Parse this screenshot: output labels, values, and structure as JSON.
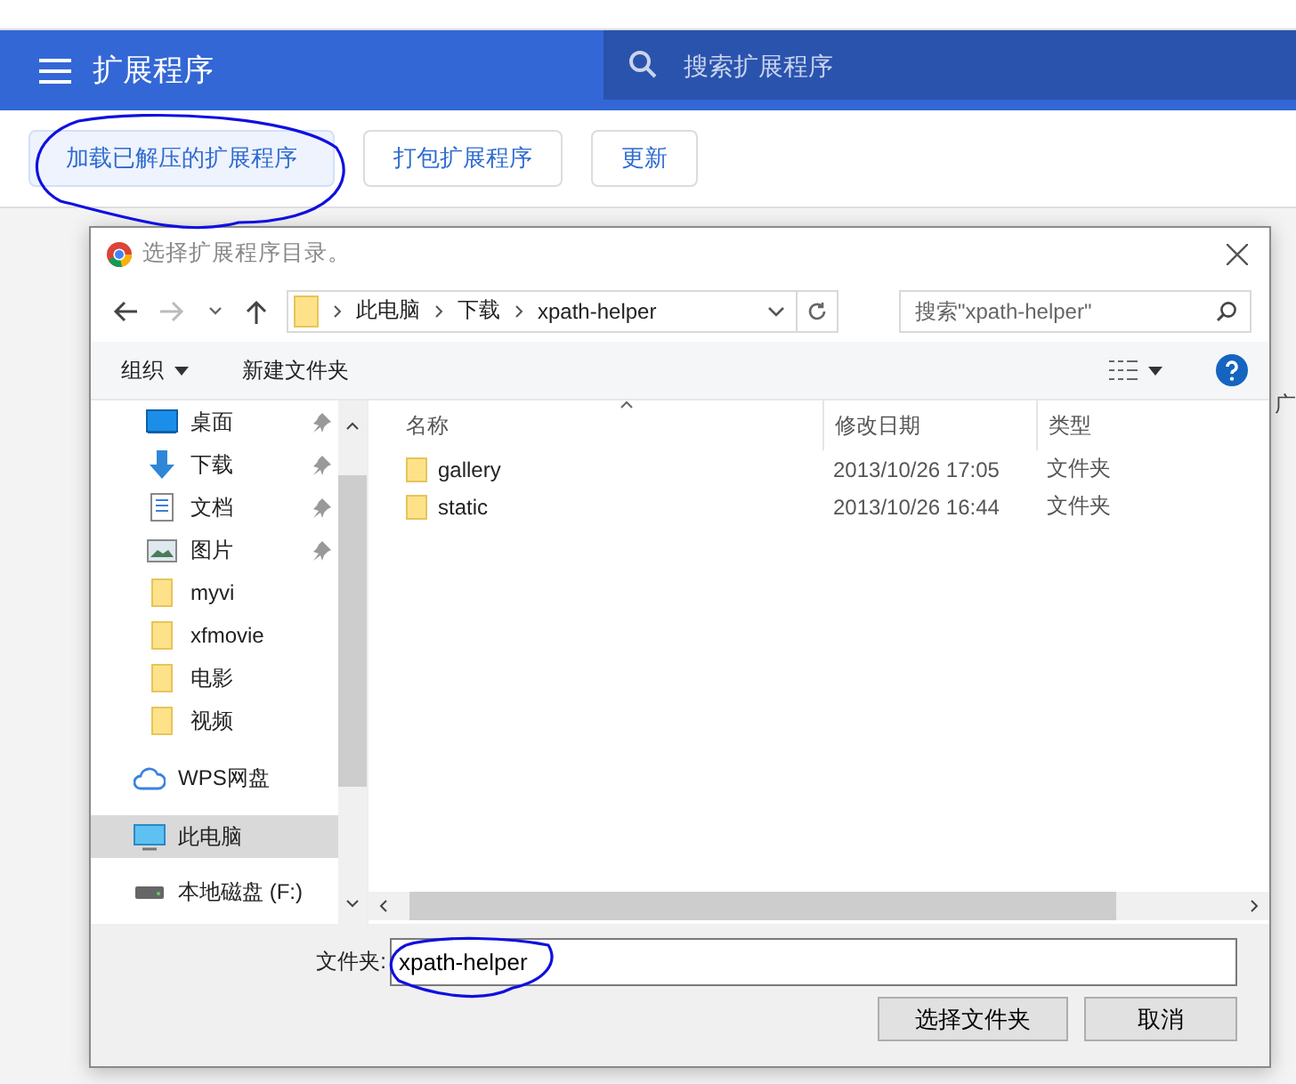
{
  "header": {
    "title": "扩展程序",
    "search_placeholder": "搜索扩展程序"
  },
  "toolbar_buttons": [
    {
      "label": "加载已解压的扩展程序",
      "selected": true
    },
    {
      "label": "打包扩展程序",
      "selected": false
    },
    {
      "label": "更新",
      "selected": false
    }
  ],
  "background_fragment": "广",
  "dialog": {
    "title": "选择扩展程序目录。",
    "breadcrumb": [
      "此电脑",
      "下载",
      "xpath-helper"
    ],
    "search_placeholder": "搜索\"xpath-helper\"",
    "organize": "组织",
    "new_folder": "新建文件夹",
    "sidebar": [
      {
        "label": "桌面",
        "kind": "desktop",
        "pinned": true,
        "selected": false
      },
      {
        "label": "下载",
        "kind": "download",
        "pinned": true,
        "selected": false
      },
      {
        "label": "文档",
        "kind": "document",
        "pinned": true,
        "selected": false
      },
      {
        "label": "图片",
        "kind": "picture",
        "pinned": true,
        "selected": false
      },
      {
        "label": "myvi",
        "kind": "folder",
        "pinned": false,
        "selected": false
      },
      {
        "label": "xfmovie",
        "kind": "folder",
        "pinned": false,
        "selected": false
      },
      {
        "label": "电影",
        "kind": "folder",
        "pinned": false,
        "selected": false
      },
      {
        "label": "视频",
        "kind": "folder",
        "pinned": false,
        "selected": false
      },
      {
        "label": "WPS网盘",
        "kind": "cloud",
        "pinned": false,
        "selected": false
      },
      {
        "label": "此电脑",
        "kind": "pc",
        "pinned": false,
        "selected": true
      },
      {
        "label": "本地磁盘 (F:)",
        "kind": "drive",
        "pinned": false,
        "selected": false
      }
    ],
    "columns": [
      "名称",
      "修改日期",
      "类型"
    ],
    "files": [
      {
        "name": "gallery",
        "modified": "2013/10/26 17:05",
        "type": "文件夹"
      },
      {
        "name": "static",
        "modified": "2013/10/26 16:44",
        "type": "文件夹"
      }
    ],
    "folder_label": "文件夹:",
    "folder_value": "xpath-helper",
    "buttons": [
      "选择文件夹",
      "取消"
    ]
  }
}
